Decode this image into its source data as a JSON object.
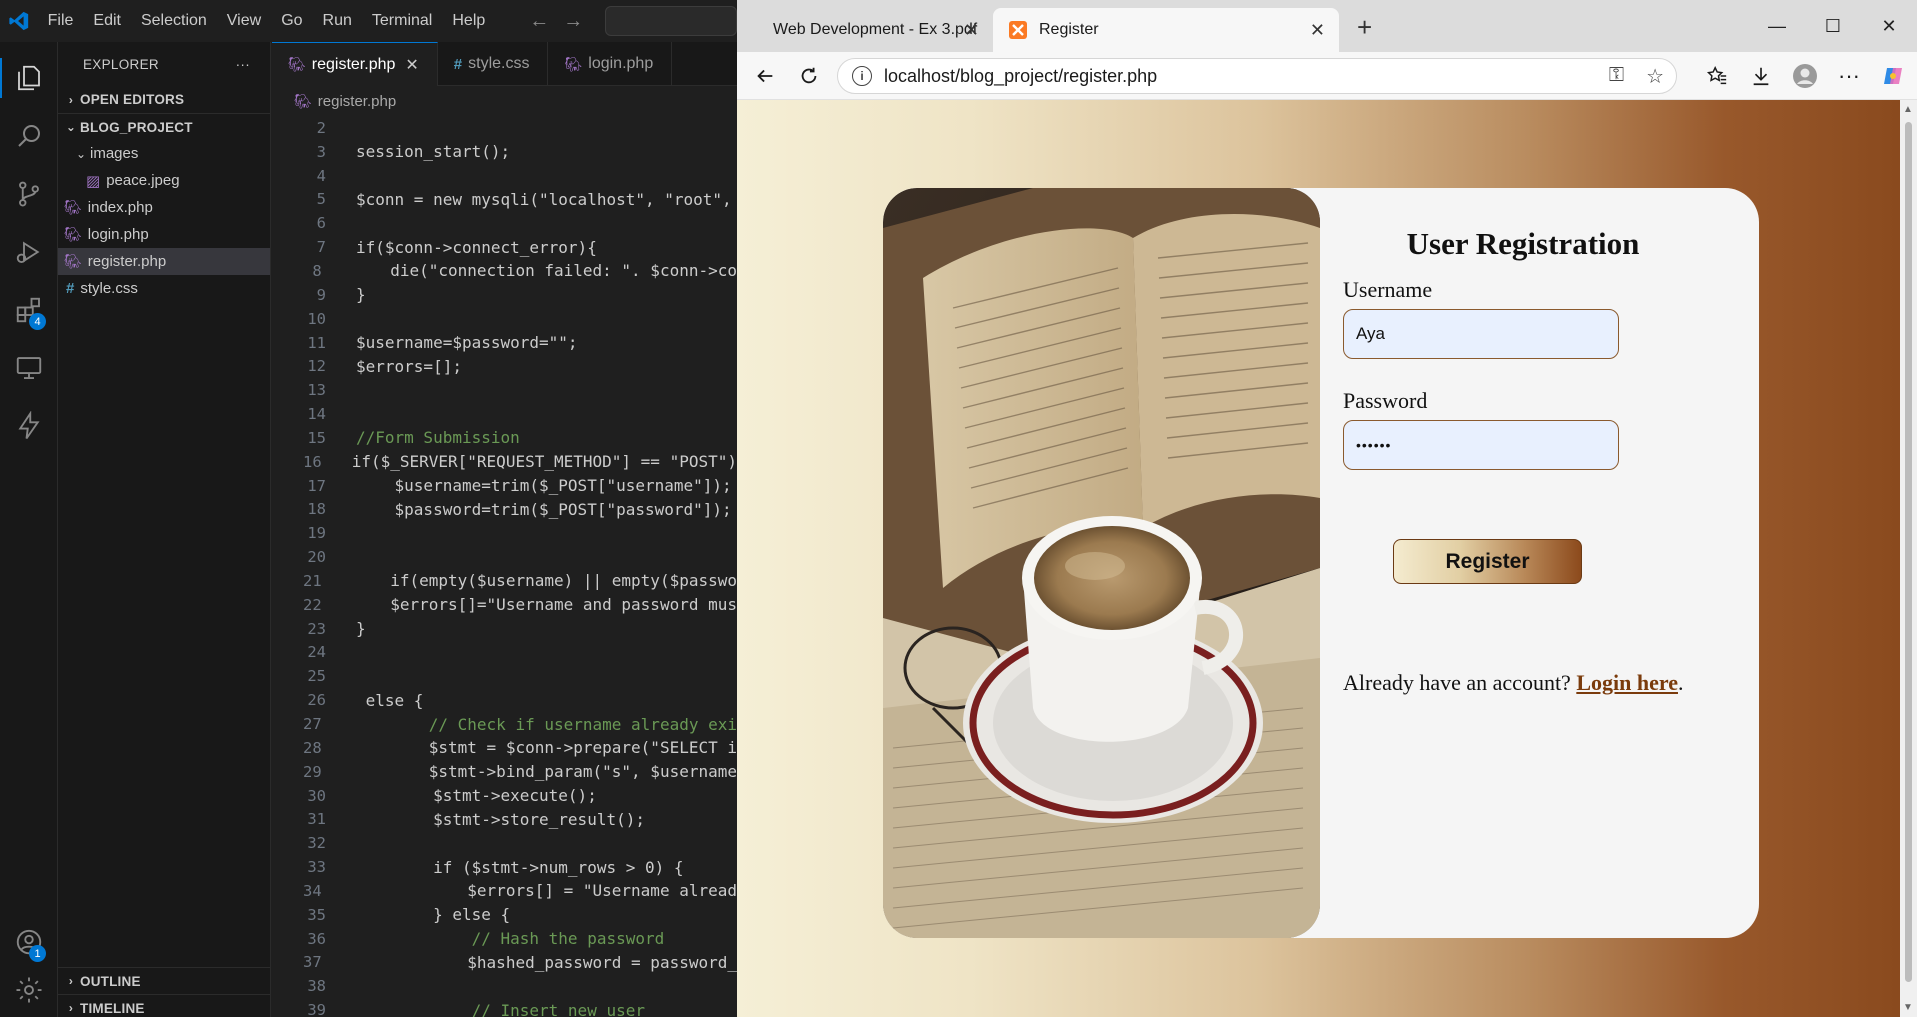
{
  "vscode": {
    "menu": [
      "File",
      "Edit",
      "Selection",
      "View",
      "Go",
      "Run",
      "Terminal",
      "Help"
    ],
    "activity_badges": {
      "extensions": "4",
      "accounts": "1"
    },
    "explorer": {
      "header": "EXPLORER",
      "more": "···",
      "open_editors": "OPEN EDITORS",
      "project": "BLOG_PROJECT",
      "folder": "images",
      "files": {
        "peace": "peace.jpeg",
        "index": "index.php",
        "login": "login.php",
        "register": "register.php",
        "style": "style.css"
      },
      "outline": "OUTLINE",
      "timeline": "TIMELINE"
    },
    "tabs": {
      "register": "register.php",
      "style": "style.css",
      "login": "login.php"
    },
    "breadcrumb": "register.php",
    "code_lines": [
      {
        "n": "2",
        "t": ""
      },
      {
        "n": "3",
        "t": "session_start();"
      },
      {
        "n": "4",
        "t": ""
      },
      {
        "n": "5",
        "t": "$conn = new mysqli(\"localhost\", \"root\","
      },
      {
        "n": "6",
        "t": ""
      },
      {
        "n": "7",
        "t": "if($conn->connect_error){"
      },
      {
        "n": "8",
        "t": "    die(\"connection failed: \". $conn->co"
      },
      {
        "n": "9",
        "t": "}"
      },
      {
        "n": "10",
        "t": ""
      },
      {
        "n": "11",
        "t": "$username=$password=\"\";"
      },
      {
        "n": "12",
        "t": "$errors=[];"
      },
      {
        "n": "13",
        "t": ""
      },
      {
        "n": "14",
        "t": ""
      },
      {
        "n": "15",
        "t": "//Form Submission"
      },
      {
        "n": "16",
        "t": "if($_SERVER[\"REQUEST_METHOD\"] == \"POST\")"
      },
      {
        "n": "17",
        "t": "    $username=trim($_POST[\"username\"]);"
      },
      {
        "n": "18",
        "t": "    $password=trim($_POST[\"password\"]);"
      },
      {
        "n": "19",
        "t": ""
      },
      {
        "n": "20",
        "t": ""
      },
      {
        "n": "21",
        "t": "    if(empty($username) || empty($passwo"
      },
      {
        "n": "22",
        "t": "    $errors[]=\"Username and password mus"
      },
      {
        "n": "23",
        "t": "}"
      },
      {
        "n": "24",
        "t": ""
      },
      {
        "n": "25",
        "t": ""
      },
      {
        "n": "26",
        "t": " else {"
      },
      {
        "n": "27",
        "t": "        // Check if username already exi"
      },
      {
        "n": "28",
        "t": "        $stmt = $conn->prepare(\"SELECT i"
      },
      {
        "n": "29",
        "t": "        $stmt->bind_param(\"s\", $username"
      },
      {
        "n": "30",
        "t": "        $stmt->execute();"
      },
      {
        "n": "31",
        "t": "        $stmt->store_result();"
      },
      {
        "n": "32",
        "t": ""
      },
      {
        "n": "33",
        "t": "        if ($stmt->num_rows > 0) {"
      },
      {
        "n": "34",
        "t": "            $errors[] = \"Username alread"
      },
      {
        "n": "35",
        "t": "        } else {"
      },
      {
        "n": "36",
        "t": "            // Hash the password"
      },
      {
        "n": "37",
        "t": "            $hashed_password = password_"
      },
      {
        "n": "38",
        "t": ""
      },
      {
        "n": "39",
        "t": "            // Insert new user"
      }
    ]
  },
  "browser": {
    "tab1": "Web Development - Ex 3.pdf",
    "tab2": "Register",
    "url": "localhost/blog_project/register.php",
    "page": {
      "heading": "User Registration",
      "username_label": "Username",
      "username_value": "Aya",
      "password_label": "Password",
      "password_value": "••••••",
      "register_button": "Register",
      "already_text": "Already have an account? ",
      "login_link": "Login here",
      "period": "."
    }
  }
}
